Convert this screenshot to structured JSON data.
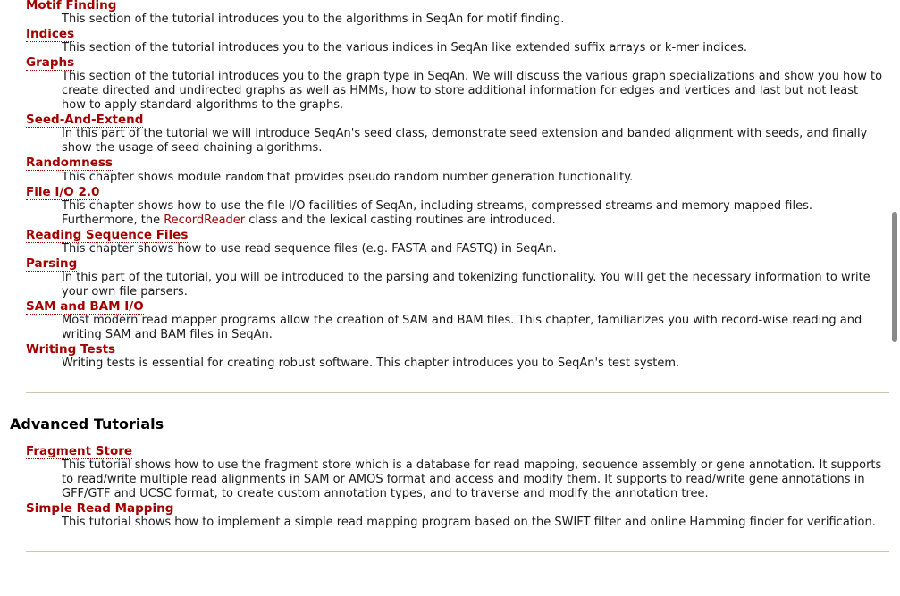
{
  "tutorials": [
    {
      "title": "Motif Finding",
      "desc": [
        "This section of the tutorial introduces you to the algorithms in SeqAn for motif finding."
      ]
    },
    {
      "title": "Indices",
      "desc": [
        "This section of the tutorial introduces you to the various indices in SeqAn like extended suffix arrays or k-mer indices."
      ]
    },
    {
      "title": "Graphs",
      "desc": [
        "This section of the tutorial introduces you to the graph type in SeqAn. We will discuss the various graph specializations and show you how to create directed and undirected graphs as well as HMMs, how to store additional information for edges and vertices and last but not least how to apply standard algorithms to the graphs."
      ]
    },
    {
      "title": "Seed-And-Extend",
      "desc": [
        "In this part of the tutorial we will introduce SeqAn's seed class, demonstrate seed extension and banded alignment with seeds, and finally show the usage of seed chaining algorithms."
      ]
    },
    {
      "title": "Randomness",
      "desc_before": "This chapter shows module ",
      "desc_code": "random",
      "desc_after": " that provides pseudo random number generation functionality."
    },
    {
      "title": "File I/O 2.0",
      "desc_before": "This chapter shows how to use the file I/O facilities of SeqAn, including streams, compressed streams and memory mapped files. Furthermore, the ",
      "desc_link": "RecordReader",
      "desc_after": " class and the lexical casting routines are introduced."
    },
    {
      "title": "Reading Sequence Files",
      "desc": [
        "This chapter shows how to use read sequence files (e.g. FASTA and FASTQ) in SeqAn."
      ]
    },
    {
      "title": "Parsing",
      "desc": [
        "In this part of the tutorial, you will be introduced to the parsing and tokenizing functionality. You will get the necessary information to write your own file parsers."
      ]
    },
    {
      "title": "SAM and BAM I/O",
      "desc": [
        "Most modern read mapper programs allow the creation of SAM and BAM files. This chapter, familiarizes you with record-wise reading and writing SAM and BAM files in SeqAn."
      ]
    },
    {
      "title": "Writing Tests",
      "desc": [
        "Writing tests is essential for creating robust software. This chapter introduces you to SeqAn's test system."
      ]
    }
  ],
  "advanced": {
    "heading": "Advanced Tutorials",
    "items": [
      {
        "title": "Fragment Store",
        "desc": "This tutorial shows how to use the fragment store which is a database for read mapping, sequence assembly or gene annotation. It supports to read/write multiple read alignments in SAM or AMOS format and access and modify them. It supports to read/write gene annotations in GFF/GTF and UCSC format, to create custom annotation types, and to traverse and modify the annotation tree."
      },
      {
        "title": "Simple Read Mapping",
        "desc": "This tutorial shows how to implement a simple read mapping program based on the SWIFT filter and online Hamming finder for verification."
      }
    ]
  },
  "colors": {
    "link": "#a40000",
    "rule": "#cbc5b0",
    "scroll_thumb": "#8a8a8a"
  },
  "scroll_position": 0.53
}
